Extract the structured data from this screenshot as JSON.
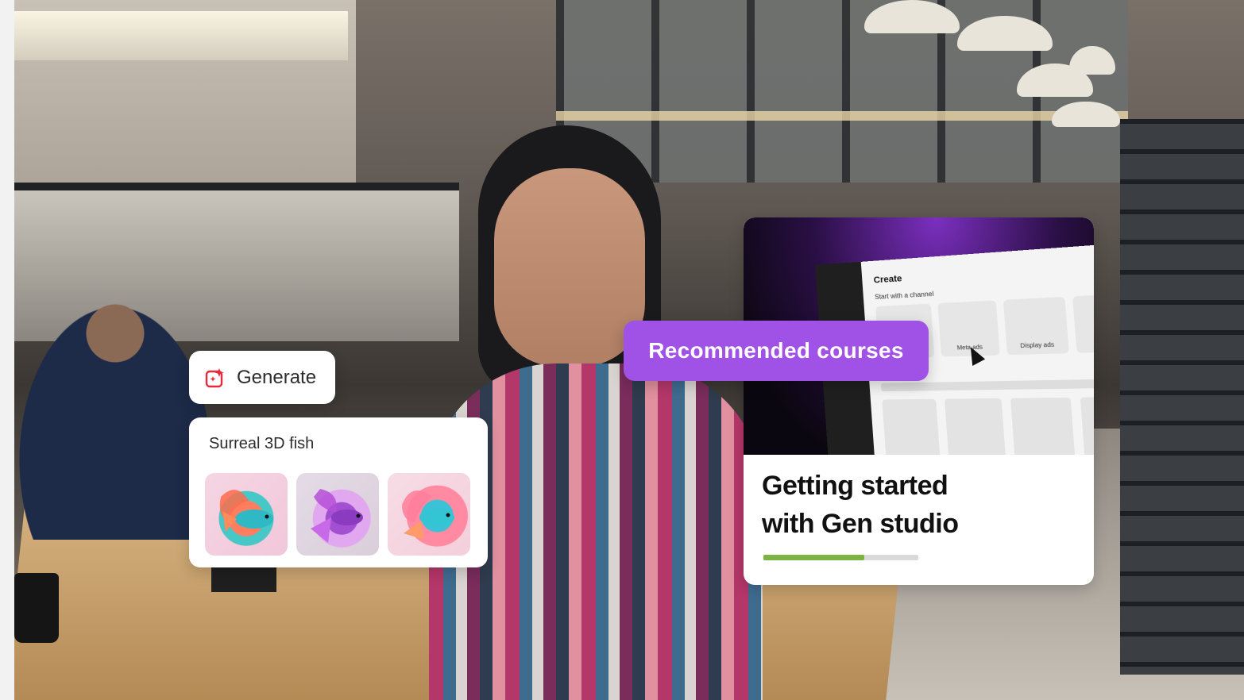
{
  "generate_chip": {
    "icon": "sparkle-image-icon",
    "label": "Generate"
  },
  "prompt_card": {
    "prompt": "Surreal 3D fish",
    "thumbnails": [
      {
        "icon": "fish-image-icon"
      },
      {
        "icon": "fish-image-icon"
      },
      {
        "icon": "fish-image-icon"
      }
    ]
  },
  "recommended": {
    "label": "Recommended courses"
  },
  "course": {
    "title_line1": "Getting started",
    "title_line2": "with Gen studio",
    "progress": 0.65,
    "screenshot": {
      "heading": "Create",
      "subheading": "Start with a channel",
      "tiles": [
        "Meta ads",
        "Display ads"
      ]
    }
  },
  "colors": {
    "accent_purple": "#a152e6",
    "progress_green": "#7cb342",
    "progress_track": "#dadada",
    "generate_icon": "#e8283b"
  }
}
